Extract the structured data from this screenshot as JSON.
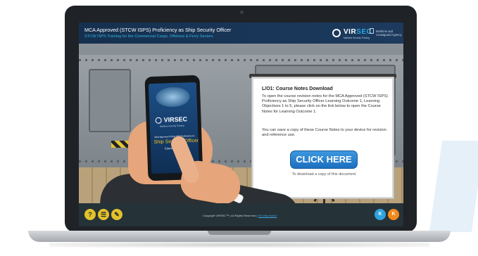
{
  "header": {
    "title": "MCA Approved (STCW ISPS) Proficiency as Ship Security Officer",
    "subtitle": "STCW ISPS Training for the Commercial Cargo, Offshore & Ferry Sectors",
    "logo_text_a": "VIR",
    "logo_text_b": "SEC",
    "logo_tag": "Maritime Security Training",
    "agency": "Maritime and Coastguard Agency"
  },
  "phone": {
    "logo": "VIRSEC",
    "tag": "Maritime Security Training",
    "small_title": "MCA Approved STCW ISPS Proficiency as",
    "course": "Ship Security Officer",
    "notes": "Course Notes"
  },
  "board": {
    "title": "L/O1: Course Notes Download",
    "paragraph1": "To open the course revision notes for the MCA Approved (STCW ISPS) Proficiency as Ship Security Officer Learning Outcome 1, Learning Objectives 1 to 5, please click on the link below to open the Course Notes for Learning Outcome 1.",
    "paragraph2": "You can save a copy of these Course Notes to your device for revision and reference use.",
    "button": "CLICK HERE",
    "note": "To download a copy of this document"
  },
  "footer": {
    "help": "?",
    "menu": "☰",
    "edit": "✎",
    "copyright": "Copyright VIRSEC™ | All Rights Reserved |",
    "security_link": "Security Notice",
    "back": "K",
    "forward": "K"
  },
  "colors": {
    "header_bg": "#1c3a5e",
    "accent_blue": "#34b6e6",
    "footer_yellow": "#e3c12a",
    "nav_blue": "#2ea3e0",
    "nav_orange": "#f08a1c"
  }
}
